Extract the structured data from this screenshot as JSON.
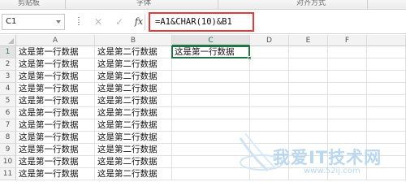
{
  "ribbon": {
    "groups": [
      "剪贴板",
      "字体",
      "对齐方式"
    ]
  },
  "formula_bar": {
    "name_box": "C1",
    "cancel_icon": "close-icon",
    "enter_icon": "check-icon",
    "fx_label": "fx",
    "formula": "=A1&CHAR(10)&B1",
    "highlight_color": "#e23a3a"
  },
  "grid": {
    "columns": [
      "A",
      "B",
      "C",
      "D",
      "E",
      "F"
    ],
    "active_column": "C",
    "rows": [
      "1",
      "2",
      "3",
      "4",
      "5",
      "6",
      "7",
      "8",
      "9",
      "10",
      "11"
    ],
    "active_row": "1",
    "column_a": [
      "这是第一行数据",
      "这是第一行数据",
      "这是第一行数据",
      "这是第一行数据",
      "这是第一行数据",
      "这是第一行数据",
      "这是第一行数据",
      "这是第一行数据",
      "这是第一行数据",
      "这是第一行数据",
      "这是第一行数据"
    ],
    "column_b": [
      "这是第二行数据",
      "这是第二行数据",
      "这是第二行数据",
      "这是第二行数据",
      "这是第二行数据",
      "这是第二行数据",
      "这是第二行数据",
      "这是第二行数据",
      "这是第二行数据",
      "这是第二行数据",
      "这是第二行数据"
    ],
    "selected_cell": {
      "ref": "C1",
      "value": "这是第一行数据"
    },
    "selection_color": "#217346"
  },
  "watermark": {
    "text": "我爱IT技术网",
    "url": "www.52ij.com",
    "color": "#b9d7ef"
  }
}
